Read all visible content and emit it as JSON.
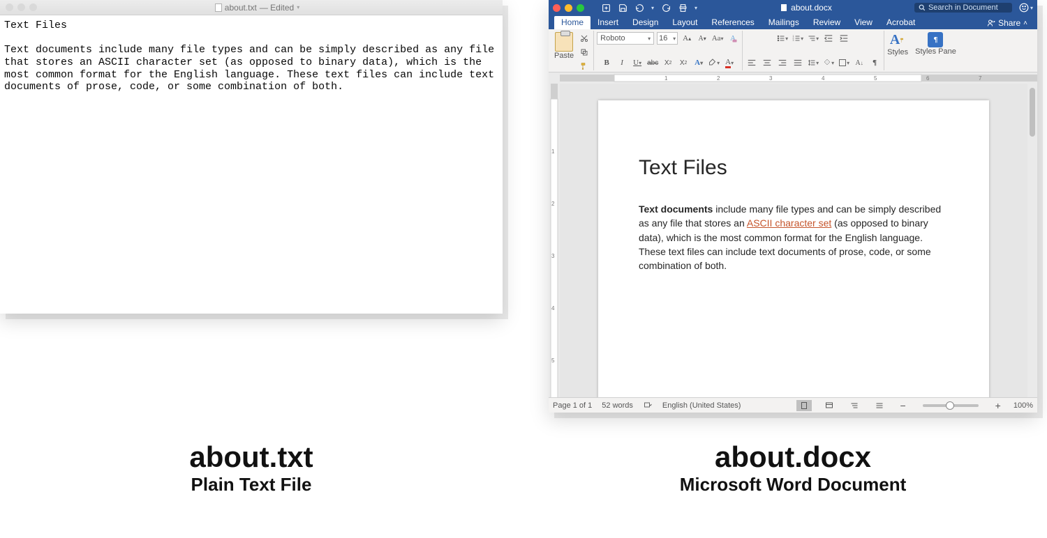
{
  "textedit": {
    "title_file": "about.txt",
    "title_suffix": "— Edited",
    "heading": "Text Files",
    "body": "Text documents include many file types and can be simply described as any file that stores an ASCII character set (as opposed to binary data), which is the most common format for the English language. These text files can include text documents of prose, code, or some combination of both."
  },
  "word": {
    "title_file": "about.docx",
    "search_placeholder": "Search in Document",
    "tabs": [
      "Home",
      "Insert",
      "Design",
      "Layout",
      "References",
      "Mailings",
      "Review",
      "View",
      "Acrobat"
    ],
    "share_label": "Share",
    "font_name": "Roboto",
    "font_size": "16",
    "paste_label": "Paste",
    "styles_label": "Styles",
    "styles_pane_label": "Styles Pane",
    "status": {
      "page": "Page 1 of 1",
      "words": "52 words",
      "lang": "English (United States)",
      "zoom": "100%"
    },
    "page_heading": "Text Files",
    "para": {
      "bold": "Text documents",
      "t1": " include many file types and can be simply described as any file that stores an ",
      "link": "ASCII character set",
      "t2": " (as opposed to binary data), which is the most common format for the English language. These text files can include text documents of prose, code, or some combination of both."
    }
  },
  "captions": {
    "left_title": "about.txt",
    "left_sub": "Plain Text File",
    "right_title": "about.docx",
    "right_sub": "Microsoft Word Document"
  }
}
